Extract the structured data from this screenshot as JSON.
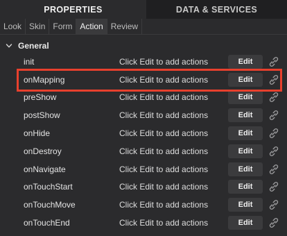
{
  "top_tabs": [
    {
      "label": "PROPERTIES",
      "active": true
    },
    {
      "label": "DATA & SERVICES",
      "active": false
    }
  ],
  "sub_tabs": [
    {
      "label": "Look",
      "active": false
    },
    {
      "label": "Skin",
      "active": false
    },
    {
      "label": "Form",
      "active": false
    },
    {
      "label": "Action",
      "active": true
    },
    {
      "label": "Review",
      "active": false
    }
  ],
  "section": {
    "title": "General",
    "expanded": true,
    "chevron_icon": "chevron-down-icon"
  },
  "actions": [
    {
      "name": "init",
      "description": "Click Edit to add actions",
      "edit_label": "Edit",
      "icon": "link-icon",
      "highlighted": false
    },
    {
      "name": "onMapping",
      "description": "Click Edit to add actions",
      "edit_label": "Edit",
      "icon": "link-icon",
      "highlighted": true
    },
    {
      "name": "preShow",
      "description": "Click Edit to add actions",
      "edit_label": "Edit",
      "icon": "link-icon",
      "highlighted": false
    },
    {
      "name": "postShow",
      "description": "Click Edit to add actions",
      "edit_label": "Edit",
      "icon": "link-icon",
      "highlighted": false
    },
    {
      "name": "onHide",
      "description": "Click Edit to add actions",
      "edit_label": "Edit",
      "icon": "link-icon",
      "highlighted": false
    },
    {
      "name": "onDestroy",
      "description": "Click Edit to add actions",
      "edit_label": "Edit",
      "icon": "link-icon",
      "highlighted": false
    },
    {
      "name": "onNavigate",
      "description": "Click Edit to add actions",
      "edit_label": "Edit",
      "icon": "link-icon",
      "highlighted": false
    },
    {
      "name": "onTouchStart",
      "description": "Click Edit to add actions",
      "edit_label": "Edit",
      "icon": "link-icon",
      "highlighted": false
    },
    {
      "name": "onTouchMove",
      "description": "Click Edit to add actions",
      "edit_label": "Edit",
      "icon": "link-icon",
      "highlighted": false
    },
    {
      "name": "onTouchEnd",
      "description": "Click Edit to add actions",
      "edit_label": "Edit",
      "icon": "link-icon",
      "highlighted": false
    }
  ],
  "colors": {
    "background": "#2b2b2d",
    "highlight_border": "#e8402d",
    "button_bg": "#3b3b3d"
  }
}
